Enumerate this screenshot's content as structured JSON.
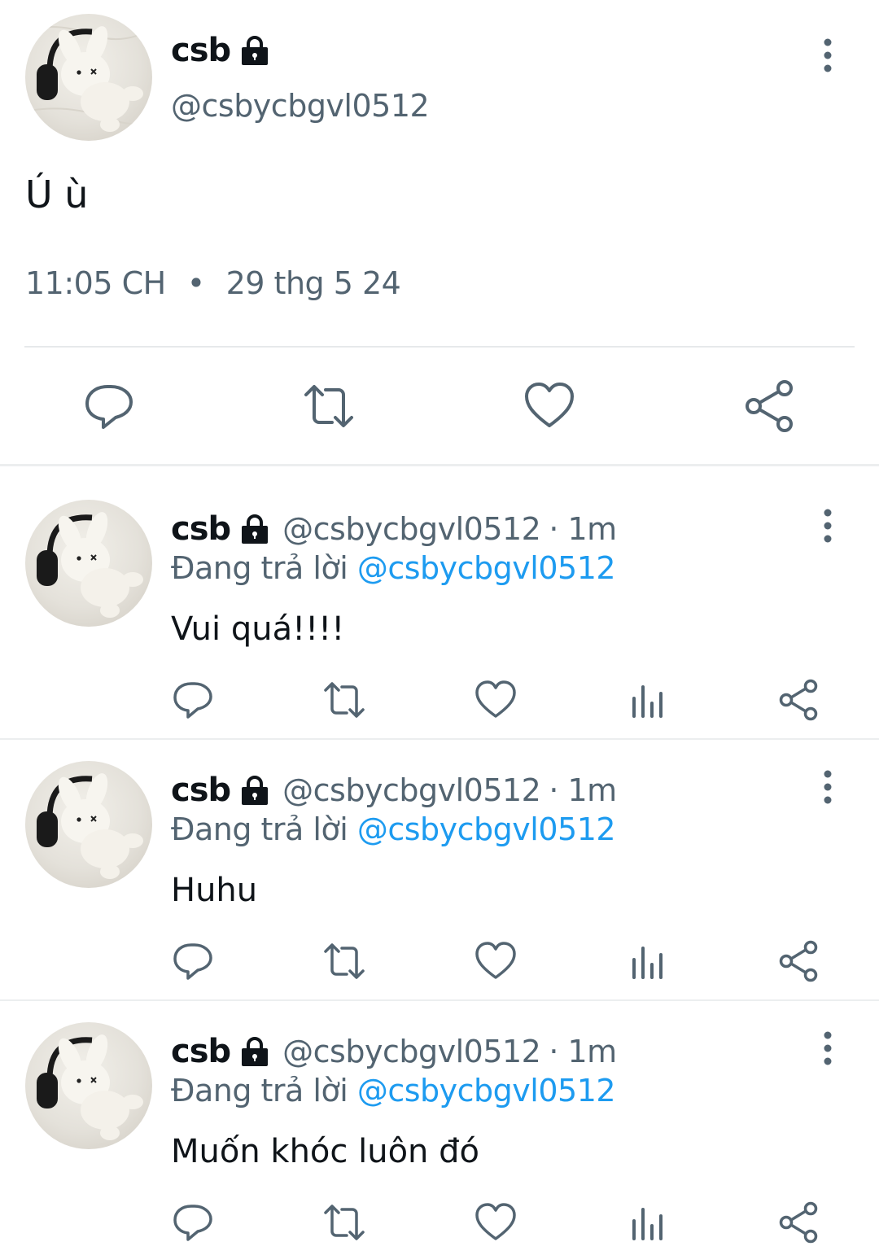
{
  "main_tweet": {
    "name": "csb",
    "handle": "@csbycbgvl0512",
    "text": "Ú ù",
    "time": "11:05 CH",
    "separator": "•",
    "date": "29 thg 5 24"
  },
  "replies": [
    {
      "name": "csb",
      "handle": "@csbycbgvl0512",
      "time": "· 1m",
      "replying_prefix": "Đang trả lời ",
      "replying_to": "@csbycbgvl0512",
      "text": "Vui quá!!!!"
    },
    {
      "name": "csb",
      "handle": "@csbycbgvl0512",
      "time": "· 1m",
      "replying_prefix": "Đang trả lời ",
      "replying_to": "@csbycbgvl0512",
      "text": "Huhu"
    },
    {
      "name": "csb",
      "handle": "@csbycbgvl0512",
      "time": "· 1m",
      "replying_prefix": "Đang trả lời ",
      "replying_to": "@csbycbgvl0512",
      "text": "Muốn khóc luôn đó"
    }
  ],
  "colors": {
    "text": "#0f1419",
    "secondary": "#536471",
    "link": "#1d9bf0",
    "divider": "#e6e9eb"
  },
  "icons": {
    "lock": "lock-icon",
    "more": "more-vertical-icon",
    "reply": "reply-icon",
    "retweet": "retweet-icon",
    "like": "heart-icon",
    "views": "views-chart-icon",
    "share": "share-icon"
  }
}
